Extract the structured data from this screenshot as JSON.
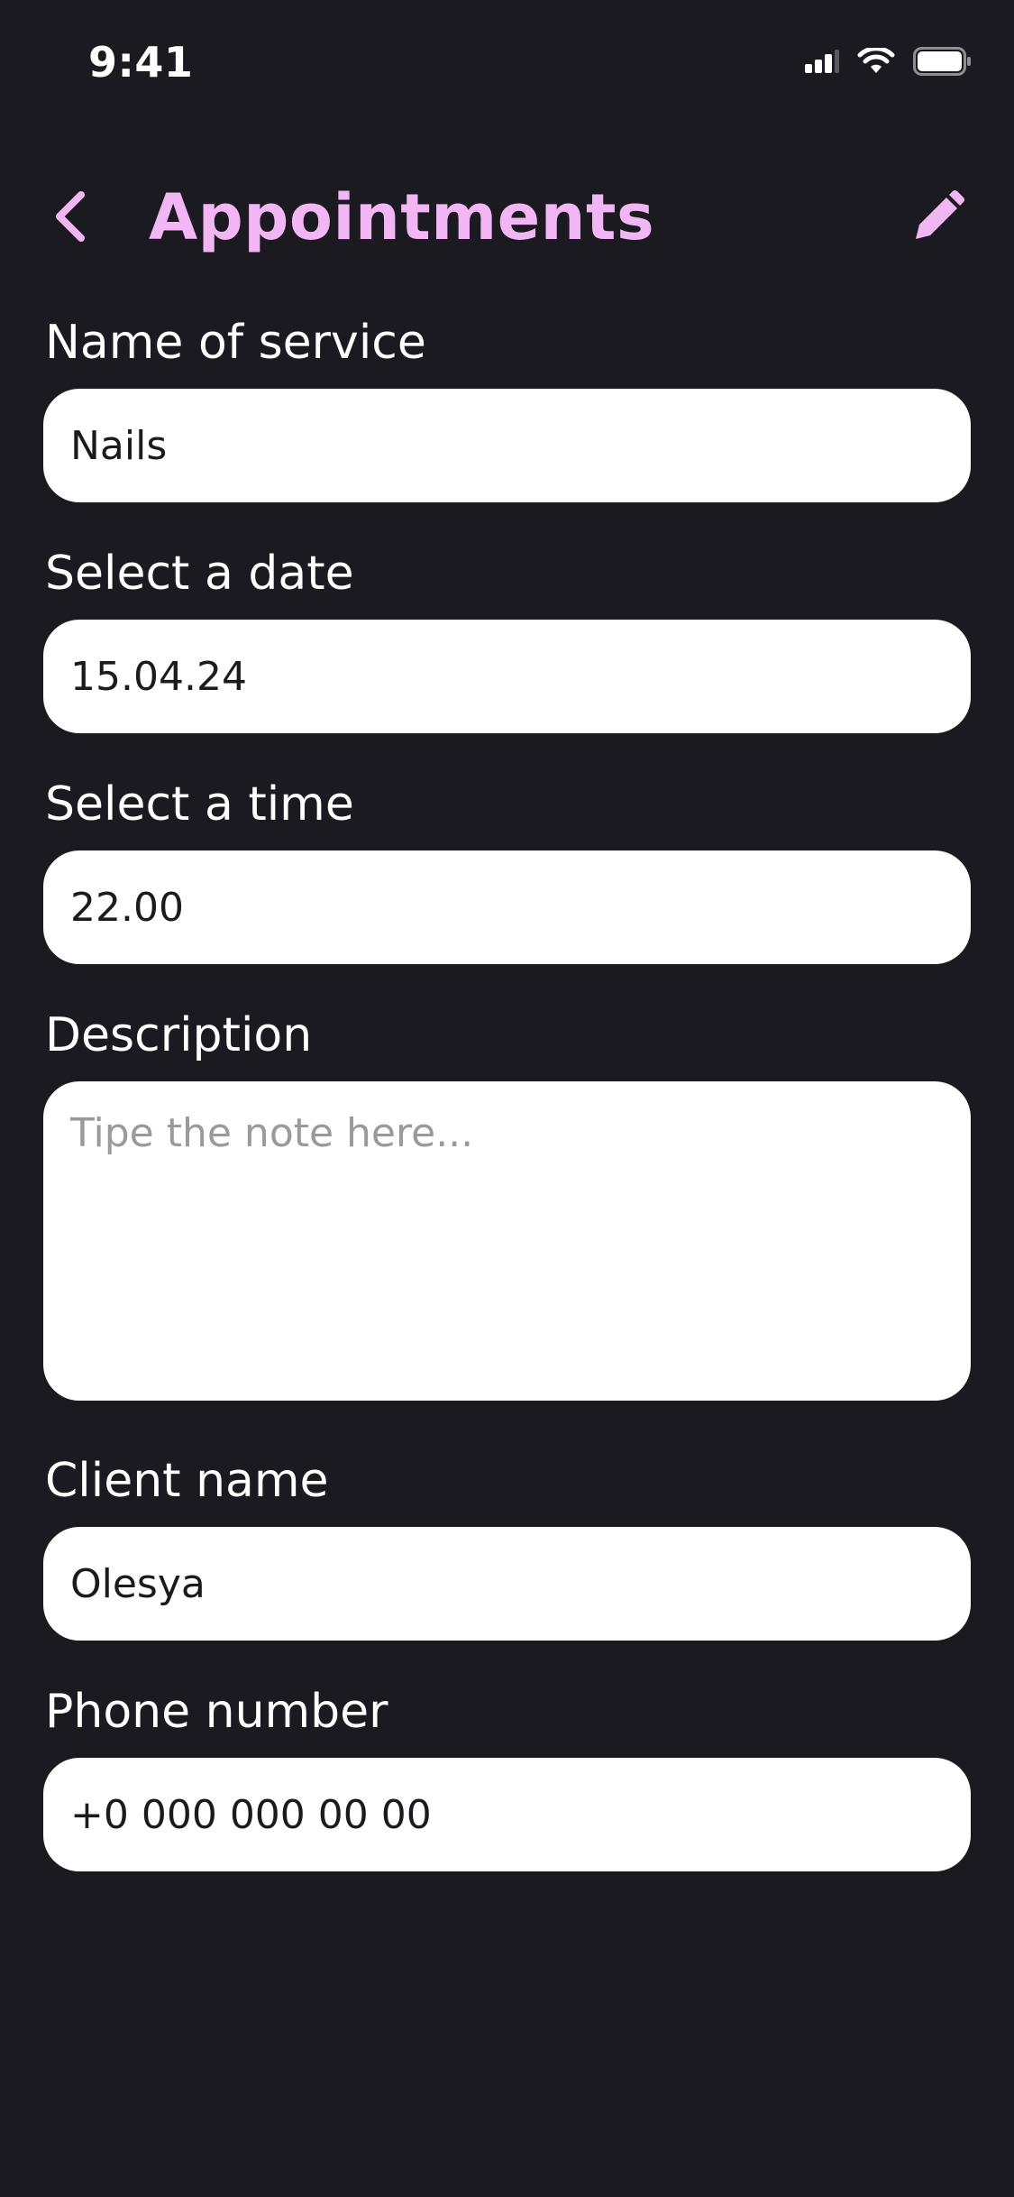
{
  "status_bar": {
    "time": "9:41"
  },
  "nav": {
    "title": "Appointments",
    "accent_color": "#f2b6f5"
  },
  "form": {
    "service": {
      "label": "Name of service",
      "value": "Nails"
    },
    "date": {
      "label": "Select a date",
      "value": "15.04.24"
    },
    "time": {
      "label": "Select a time",
      "value": "22.00"
    },
    "description": {
      "label": "Description",
      "placeholder": "Tipe the note here...",
      "value": ""
    },
    "client": {
      "label": "Client name",
      "value": "Olesya"
    },
    "phone": {
      "label": "Phone number",
      "value": "+0 000 000 00 00"
    }
  },
  "icons": {
    "back": "chevron-left-icon",
    "edit": "pencil-icon",
    "signal": "cellular-signal-icon",
    "wifi": "wifi-icon",
    "battery": "battery-icon"
  }
}
